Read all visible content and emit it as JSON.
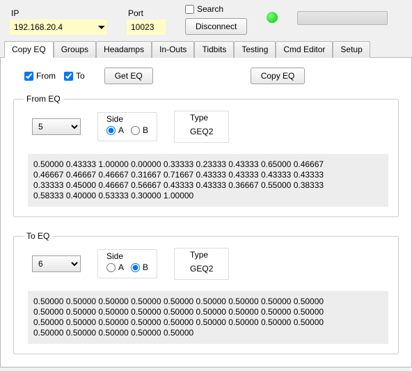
{
  "toolbar": {
    "ip_label": "IP",
    "ip_value": "192.168.20.4",
    "port_label": "Port",
    "port_value": "10023",
    "search_label": "Search",
    "search_checked": false,
    "disconnect_label": "Disconnect",
    "status_color": "#00d000"
  },
  "tabs": [
    {
      "id": "copy-eq",
      "label": "Copy EQ",
      "active": true
    },
    {
      "id": "groups",
      "label": "Groups",
      "active": false
    },
    {
      "id": "headamps",
      "label": "Headamps",
      "active": false
    },
    {
      "id": "in-outs",
      "label": "In-Outs",
      "active": false
    },
    {
      "id": "tidbits",
      "label": "Tidbits",
      "active": false
    },
    {
      "id": "testing",
      "label": "Testing",
      "active": false
    },
    {
      "id": "cmd-editor",
      "label": "Cmd Editor",
      "active": false
    },
    {
      "id": "setup",
      "label": "Setup",
      "active": false
    }
  ],
  "options": {
    "from_label": "From",
    "from_checked": true,
    "to_label": "To",
    "to_checked": true,
    "get_eq_label": "Get EQ",
    "copy_eq_label": "Copy EQ"
  },
  "from_eq": {
    "legend": "From EQ",
    "channel": "5",
    "side_label": "Side",
    "side_a": "A",
    "side_b": "B",
    "side_selected": "A",
    "type_label": "Type",
    "type_value": "GEQ2",
    "data_lines": [
      "0.50000 0.43333 1.00000 0.00000 0.33333 0.23333 0.43333 0.65000 0.46667",
      "0.46667 0.46667 0.46667 0.31667 0.71667 0.43333 0.43333 0.43333 0.43333",
      "0.33333 0.45000 0.46667 0.56667 0.43333 0.43333 0.36667 0.55000 0.38333",
      "0.58333 0.40000 0.53333 0.30000 1.00000"
    ]
  },
  "to_eq": {
    "legend": "To EQ",
    "channel": "6",
    "side_label": "Side",
    "side_a": "A",
    "side_b": "B",
    "side_selected": "B",
    "type_label": "Type",
    "type_value": "GEQ2",
    "data_lines": [
      "0.50000 0.50000 0.50000 0.50000 0.50000 0.50000 0.50000 0.50000 0.50000",
      "0.50000 0.50000 0.50000 0.50000 0.50000 0.50000 0.50000 0.50000 0.50000",
      "0.50000 0.50000 0.50000 0.50000 0.50000 0.50000 0.50000 0.50000 0.50000",
      "0.50000 0.50000 0.50000 0.50000 0.50000"
    ]
  }
}
